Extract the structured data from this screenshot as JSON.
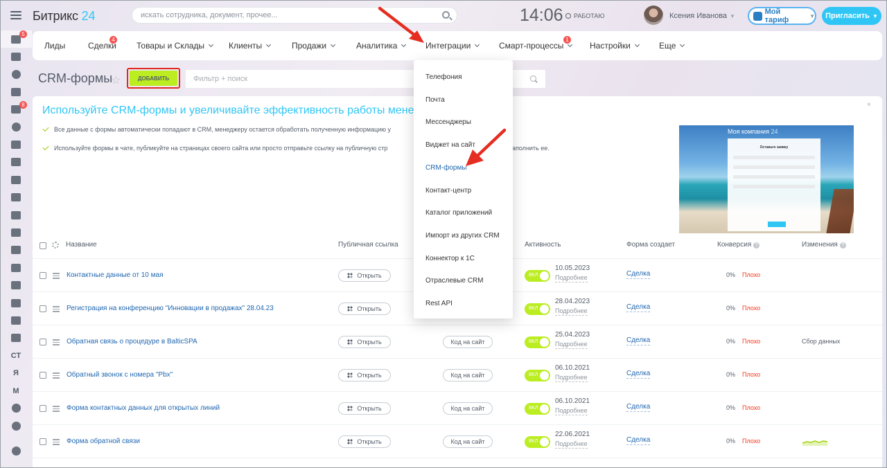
{
  "app": {
    "logo_name": "Битрикс",
    "logo_num": "24",
    "search_placeholder": "искать сотрудника, документ, прочее...",
    "clock": "14:06",
    "work_status": "РАБОТАЮ",
    "user_name": "Ксения Иванова",
    "tariff_label": "Мой тариф",
    "invite_label": "Пригласить"
  },
  "sidebar": {
    "items": [
      {
        "icon": "funnel-icon",
        "badge": "5"
      },
      {
        "icon": "home-icon",
        "badge": ""
      },
      {
        "icon": "target-icon",
        "badge": ""
      },
      {
        "icon": "cart-icon",
        "badge": ""
      },
      {
        "icon": "tasks-icon",
        "badge": "8"
      },
      {
        "icon": "robot-icon",
        "badge": ""
      },
      {
        "icon": "calendar-icon",
        "badge": ""
      },
      {
        "icon": "chat-icon",
        "badge": ""
      },
      {
        "icon": "planner-icon",
        "badge": ""
      },
      {
        "icon": "document-icon",
        "badge": ""
      },
      {
        "icon": "drive-icon",
        "badge": ""
      },
      {
        "icon": "mail-icon",
        "badge": ""
      },
      {
        "icon": "group-icon",
        "badge": ""
      },
      {
        "icon": "contacts-icon",
        "badge": ""
      },
      {
        "icon": "android-icon",
        "badge": ""
      },
      {
        "icon": "box-icon",
        "badge": ""
      },
      {
        "icon": "metrics-icon",
        "badge": ""
      },
      {
        "icon": "code-icon",
        "badge": ""
      }
    ],
    "text_items": [
      "СТ",
      "Я",
      "М"
    ],
    "bottom_icons": [
      "pen-icon",
      "more-down-icon",
      "help-icon"
    ]
  },
  "menu": {
    "items": [
      {
        "label": "Лиды",
        "chevron": false,
        "badge": ""
      },
      {
        "label": "Сделки",
        "chevron": false,
        "badge": "4"
      },
      {
        "label": "Товары и Склады",
        "chevron": true,
        "badge": ""
      },
      {
        "label": "Клиенты",
        "chevron": true,
        "badge": ""
      },
      {
        "label": "Продажи",
        "chevron": true,
        "badge": ""
      },
      {
        "label": "Аналитика",
        "chevron": true,
        "badge": ""
      },
      {
        "label": "Интеграции",
        "chevron": true,
        "badge": ""
      },
      {
        "label": "Смарт-процессы",
        "chevron": true,
        "badge": "1"
      },
      {
        "label": "Настройки",
        "chevron": true,
        "badge": ""
      },
      {
        "label": "Еще",
        "chevron": true,
        "badge": ""
      }
    ]
  },
  "page": {
    "title": "CRM-формы",
    "add_button": "ДОБАВИТЬ",
    "filter_placeholder": "Фильтр + поиск"
  },
  "promo": {
    "title": "Используйте CRM-формы и увеличивайте эффективность работы менедж",
    "line1": "Все данные с формы автоматически попадают в CRM, менеджеру остается обработать полученную информацию у",
    "line2": "Используйте формы в чате, публикуйте на страницах своего сайта или просто отправьте ссылку на публичную стр",
    "line2_tail": "аполнить ее.",
    "close": "×",
    "image_company": "Моя компания",
    "image_company_num": "24",
    "image_form_title": "Оставьте заявку"
  },
  "table": {
    "headers": {
      "name": "Название",
      "public_link": "Публичная ссылка",
      "activity": "Активность",
      "creates": "Форма создает",
      "conversion": "Конверсия",
      "changes": "Изменения"
    },
    "rows": [
      {
        "name": "Контактные данные от 10 мая",
        "open": "Открыть",
        "code": "",
        "toggle": "ВКЛ",
        "date": "10.05.2023",
        "more": "Подробнее",
        "entity": "Сделка",
        "conv": "0%",
        "quality": "Плохо",
        "change": ""
      },
      {
        "name": "Регистрация на конференцию \"Инновации в продажах\" 28.04.23",
        "open": "Открыть",
        "code": "",
        "toggle": "ВКЛ",
        "date": "28.04.2023",
        "more": "Подробнее",
        "entity": "Сделка",
        "conv": "0%",
        "quality": "Плохо",
        "change": ""
      },
      {
        "name": "Обратная связь о процедуре в BalticSPA",
        "open": "Открыть",
        "code": "Код на сайт",
        "toggle": "ВКЛ",
        "date": "25.04.2023",
        "more": "Подробнее",
        "entity": "Сделка",
        "conv": "0%",
        "quality": "Плохо",
        "change": "Сбор данных"
      },
      {
        "name": "Обратный звонок с номера \"Pbx\"",
        "open": "Открыть",
        "code": "Код на сайт",
        "toggle": "ВКЛ",
        "date": "06.10.2021",
        "more": "Подробнее",
        "entity": "Сделка",
        "conv": "0%",
        "quality": "Плохо",
        "change": ""
      },
      {
        "name": "Форма контактных данных для открытых линий",
        "open": "Открыть",
        "code": "Код на сайт",
        "toggle": "ВКЛ",
        "date": "06.10.2021",
        "more": "Подробнее",
        "entity": "Сделка",
        "conv": "0%",
        "quality": "Плохо",
        "change": ""
      },
      {
        "name": "Форма обратной связи",
        "open": "Открыть",
        "code": "Код на сайт",
        "toggle": "ВКЛ",
        "date": "22.06.2021",
        "more": "Подробнее",
        "entity": "Сделка",
        "conv": "0%",
        "quality": "Плохо",
        "change": ""
      }
    ]
  },
  "dropdown": {
    "items": [
      {
        "label": "Телефония",
        "active": false
      },
      {
        "label": "Почта",
        "active": false
      },
      {
        "label": "Мессенджеры",
        "active": false
      },
      {
        "label": "Виджет на сайт",
        "active": false
      },
      {
        "label": "CRM-формы",
        "active": true
      },
      {
        "label": "Контакт-центр",
        "active": false
      },
      {
        "label": "Каталог приложений",
        "active": false
      },
      {
        "label": "Импорт из других CRM",
        "active": false
      },
      {
        "label": "Коннектор к 1С",
        "active": false
      },
      {
        "label": "Отраслевые CRM",
        "active": false
      },
      {
        "label": "Rest API",
        "active": false
      }
    ]
  },
  "colors": {
    "accent": "#2fc6f6",
    "add_button": "#bbed21",
    "highlight": "#e0291f",
    "link": "#2067b0",
    "bad": "#f0371b"
  }
}
